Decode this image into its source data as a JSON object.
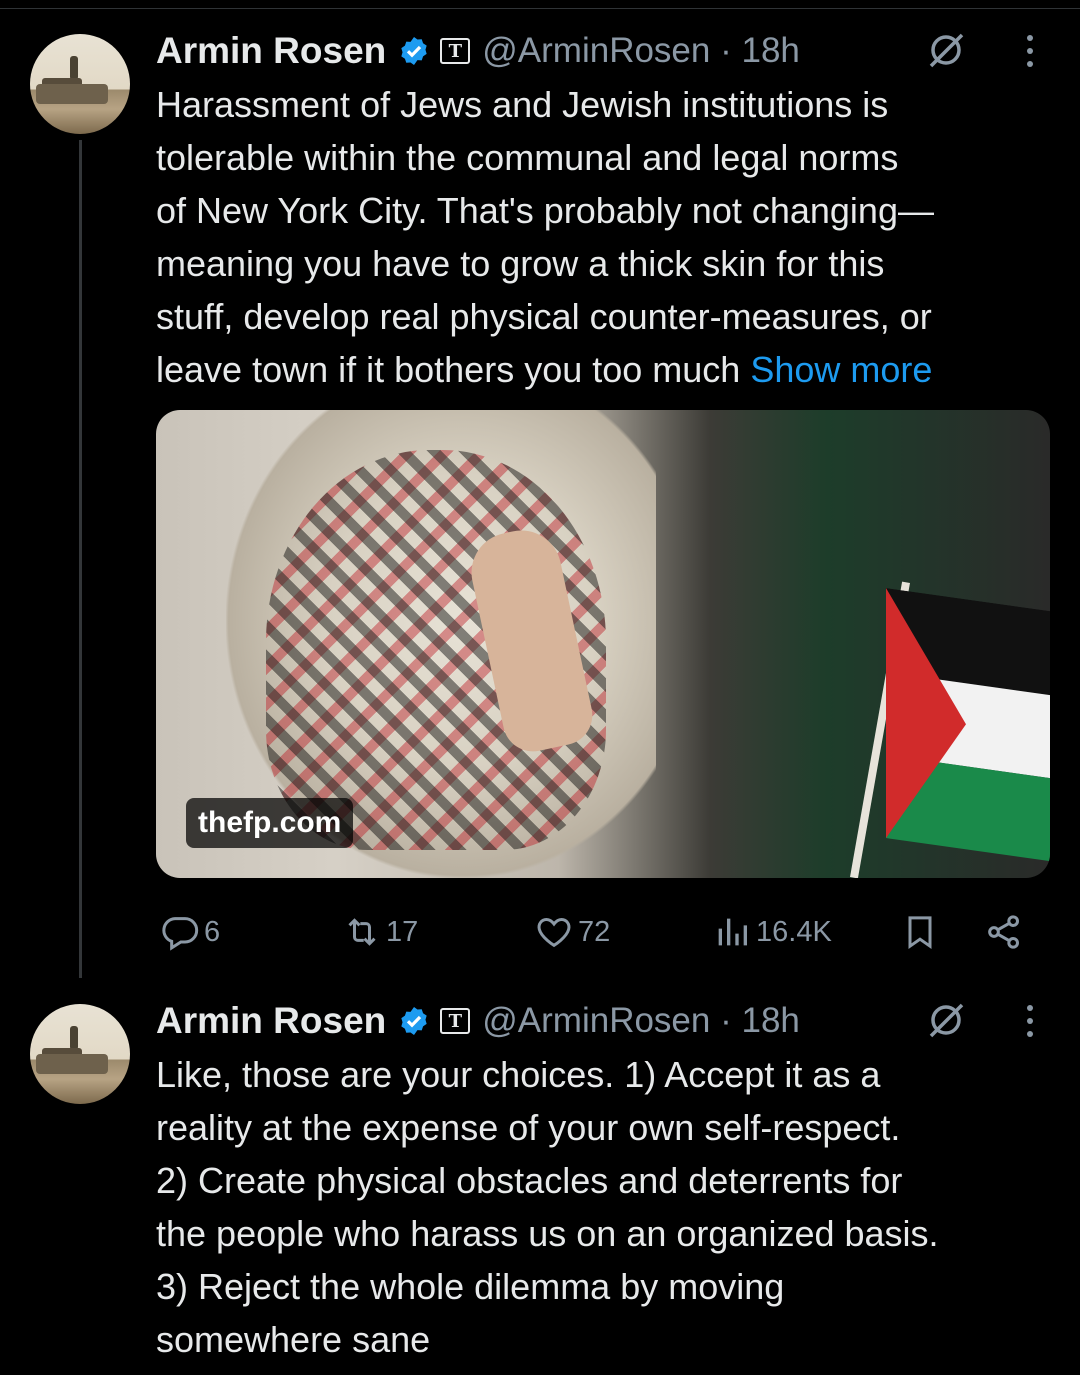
{
  "colors": {
    "background": "#000000",
    "text": "#e7e9ea",
    "muted": "#8b98a5",
    "link": "#1d9bf0",
    "verified": "#1d9bf0"
  },
  "tweets": [
    {
      "author": {
        "name": "Armin Rosen",
        "handle": "@ArminRosen",
        "time": "18h",
        "affiliate_badge": "T"
      },
      "body_lines": [
        "Harassment of Jews and Jewish institutions is",
        "tolerable within the communal and legal norms",
        "of New York City. That's probably not changing—",
        "meaning you have to grow a thick skin for this",
        "stuff, develop real physical counter-measures, or",
        "leave town if it bothers you too much"
      ],
      "show_more": "Show more",
      "card": {
        "domain": "thefp.com"
      },
      "actions": {
        "replies": "6",
        "reposts": "17",
        "likes": "72",
        "views": "16.4K"
      }
    },
    {
      "author": {
        "name": "Armin Rosen",
        "handle": "@ArminRosen",
        "time": "18h",
        "affiliate_badge": "T"
      },
      "body_lines": [
        "Like, those are your choices. 1) Accept it as a",
        "reality at the expense of your own self-respect.",
        "2) Create physical obstacles and deterrents for",
        "the people who harass us on an organized basis.",
        "3) Reject the whole dilemma by moving",
        "somewhere sane"
      ]
    }
  ]
}
